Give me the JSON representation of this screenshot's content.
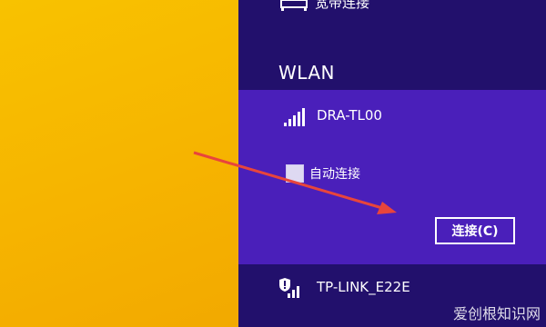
{
  "network_pane": {
    "broadband": {
      "label": "宽带连接",
      "icon": "ethernet-icon"
    },
    "section_title": "WLAN",
    "networks": [
      {
        "name": "DRA-TL00",
        "icon": "wifi-signal-icon",
        "expanded": true,
        "auto_connect_label": "自动连接",
        "auto_connect_checked": false,
        "connect_label": "连接(C)"
      },
      {
        "name": "TP-LINK_E22E",
        "icon": "wifi-signal-secured-icon",
        "expanded": false
      }
    ]
  },
  "watermark": "爱创根知识网",
  "colors": {
    "desktop": "#f6b800",
    "pane": "#22106c",
    "selected": "#4a1fba",
    "arrow": "#e8453c"
  }
}
